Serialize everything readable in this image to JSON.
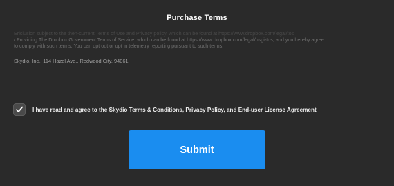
{
  "dialog": {
    "title": "Purchase Terms"
  },
  "terms": {
    "lines": [
      "Ericlusion subject to the then-current Terms of Use and Privacy policy, which can be found at https://www.dropbox.com/legal/tos",
      "/ Providing The Dropbox Government Terms of Service, which can be found at https://www.dropbox.com/legal/usgi-tos, and you hereby agree",
      "to comply with such terms. You can opt out or opt in telemetry reporting pursuant to such terms."
    ],
    "address": "Skydio, Inc., 114 Hazel Ave., Redwood City, 94061"
  },
  "agreement": {
    "checked": true,
    "label": "I have read and agree to the Skydio Terms & Conditions, Privacy Policy, and End-user License Agreement"
  },
  "actions": {
    "submit_label": "Submit"
  },
  "colors": {
    "background": "#2a2a2a",
    "accent": "#1a8df0"
  },
  "icons": {
    "checkbox": "checkmark-icon"
  }
}
